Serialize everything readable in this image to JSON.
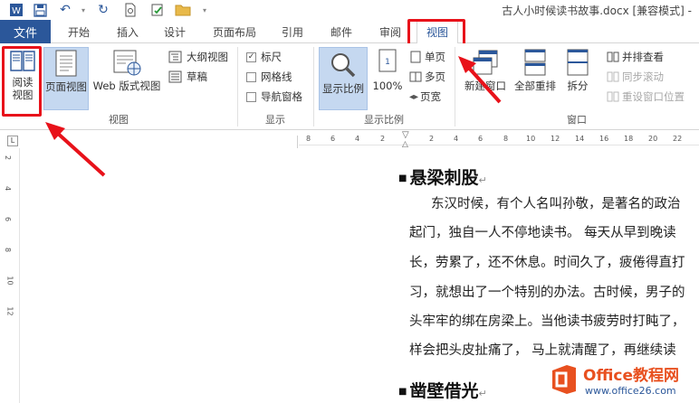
{
  "window": {
    "title": "古人小时候读书故事.docx [兼容模式] -"
  },
  "tabs": {
    "file": "文件",
    "items": [
      "开始",
      "插入",
      "设计",
      "页面布局",
      "引用",
      "邮件",
      "审阅",
      "视图"
    ],
    "active": "视图"
  },
  "ribbon": {
    "views": {
      "group_label": "视图",
      "read_mode": "阅读\n视图",
      "print_layout": "页面视图",
      "web_layout": "Web 版式视图",
      "outline": "大纲视图",
      "draft": "草稿"
    },
    "show": {
      "group_label": "显示",
      "ruler": "标尺",
      "ruler_checked": true,
      "gridlines": "网格线",
      "gridlines_checked": false,
      "nav_pane": "导航窗格",
      "nav_pane_checked": false
    },
    "zoom": {
      "group_label": "显示比例",
      "zoom": "显示比例",
      "hundred": "100%",
      "one_page": "单页",
      "multi_page": "多页",
      "page_width": "页宽"
    },
    "window": {
      "group_label": "窗口",
      "new_window": "新建窗口",
      "arrange_all": "全部重排",
      "split": "拆分",
      "side_by_side": "并排查看",
      "sync_scroll": "同步滚动",
      "reset_position": "重设窗口位置"
    }
  },
  "rulers": {
    "top_ticks": [
      "8",
      "6",
      "4",
      "2",
      "",
      "2",
      "4",
      "6",
      "8",
      "10",
      "12",
      "14",
      "16",
      "18",
      "20",
      "22"
    ],
    "left_ticks": [
      "2",
      "4",
      "6",
      "8",
      "10",
      "12"
    ],
    "corner": "L"
  },
  "document": {
    "heading1": "悬梁刺股",
    "lines": [
      "东汉时候，有个人名叫孙敬，是著名的政治",
      "起门，独自一人不停地读书。 每天从早到晚读",
      "长，劳累了，还不休息。时间久了，疲倦得直打",
      "习，就想出了一个特别的办法。古时候，男子的",
      "头牢牢的绑在房梁上。当他读书疲劳时打盹了，",
      "样会把头皮扯痛了，  马上就清醒了，再继续读"
    ],
    "heading2": "凿壁借光",
    "para_mark": "↵"
  },
  "watermark": {
    "brand": "Office教程网",
    "url": "www.office26.com"
  },
  "colors": {
    "accent": "#2b579a",
    "highlight": "#e8121a",
    "selected": "#c5d8f0"
  }
}
